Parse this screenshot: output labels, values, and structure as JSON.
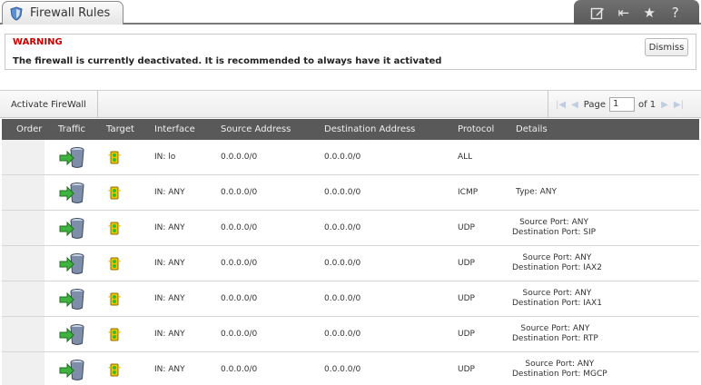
{
  "window": {
    "title": "Firewall Rules",
    "icons": [
      "shield-icon",
      "edit-icon",
      "collapse-icon",
      "star-icon",
      "help-icon"
    ],
    "toolbar_glyphs": {
      "help": "?",
      "collapse": "⇤",
      "star": "★"
    }
  },
  "warning": {
    "title": "WARNING",
    "message": "The firewall is currently deactivated. It is recommended to always have it activated",
    "dismiss_label": "Dismiss"
  },
  "controls": {
    "activate_label": "Activate FireWall",
    "pager": {
      "page_label": "Page",
      "page_value": "1",
      "of_label": "of 1"
    }
  },
  "table": {
    "columns": [
      "Order",
      "Traffic",
      "Target",
      "Interface",
      "Source Address",
      "Destination Address",
      "Protocol",
      "Details"
    ],
    "rows": [
      {
        "interface": "IN: lo",
        "source": "0.0.0.0/0",
        "destination": "0.0.0.0/0",
        "protocol": "ALL",
        "details": [
          "",
          ""
        ]
      },
      {
        "interface": "IN: ANY",
        "source": "0.0.0.0/0",
        "destination": "0.0.0.0/0",
        "protocol": "ICMP",
        "details": [
          "Type: ANY",
          ""
        ]
      },
      {
        "interface": "IN: ANY",
        "source": "0.0.0.0/0",
        "destination": "0.0.0.0/0",
        "protocol": "UDP",
        "details": [
          "Source Port: ANY",
          "Destination Port: SIP"
        ]
      },
      {
        "interface": "IN: ANY",
        "source": "0.0.0.0/0",
        "destination": "0.0.0.0/0",
        "protocol": "UDP",
        "details": [
          "Source Port: ANY",
          "Destination Port: IAX2"
        ]
      },
      {
        "interface": "IN: ANY",
        "source": "0.0.0.0/0",
        "destination": "0.0.0.0/0",
        "protocol": "UDP",
        "details": [
          "Source Port: ANY",
          "Destination Port: IAX1"
        ]
      },
      {
        "interface": "IN: ANY",
        "source": "0.0.0.0/0",
        "destination": "0.0.0.0/0",
        "protocol": "UDP",
        "details": [
          "Source Port: ANY",
          "Destination Port: RTP"
        ]
      },
      {
        "interface": "IN: ANY",
        "source": "0.0.0.0/0",
        "destination": "0.0.0.0/0",
        "protocol": "UDP",
        "details": [
          "Source Port: ANY",
          "Destination Port: MGCP"
        ]
      }
    ],
    "traffic_icon": "traffic-in-icon",
    "target_icon": "accept-target-icon"
  },
  "colors": {
    "warning_title": "#d10000",
    "header_bg": "#595959",
    "toolbar_bg": "#666666"
  }
}
